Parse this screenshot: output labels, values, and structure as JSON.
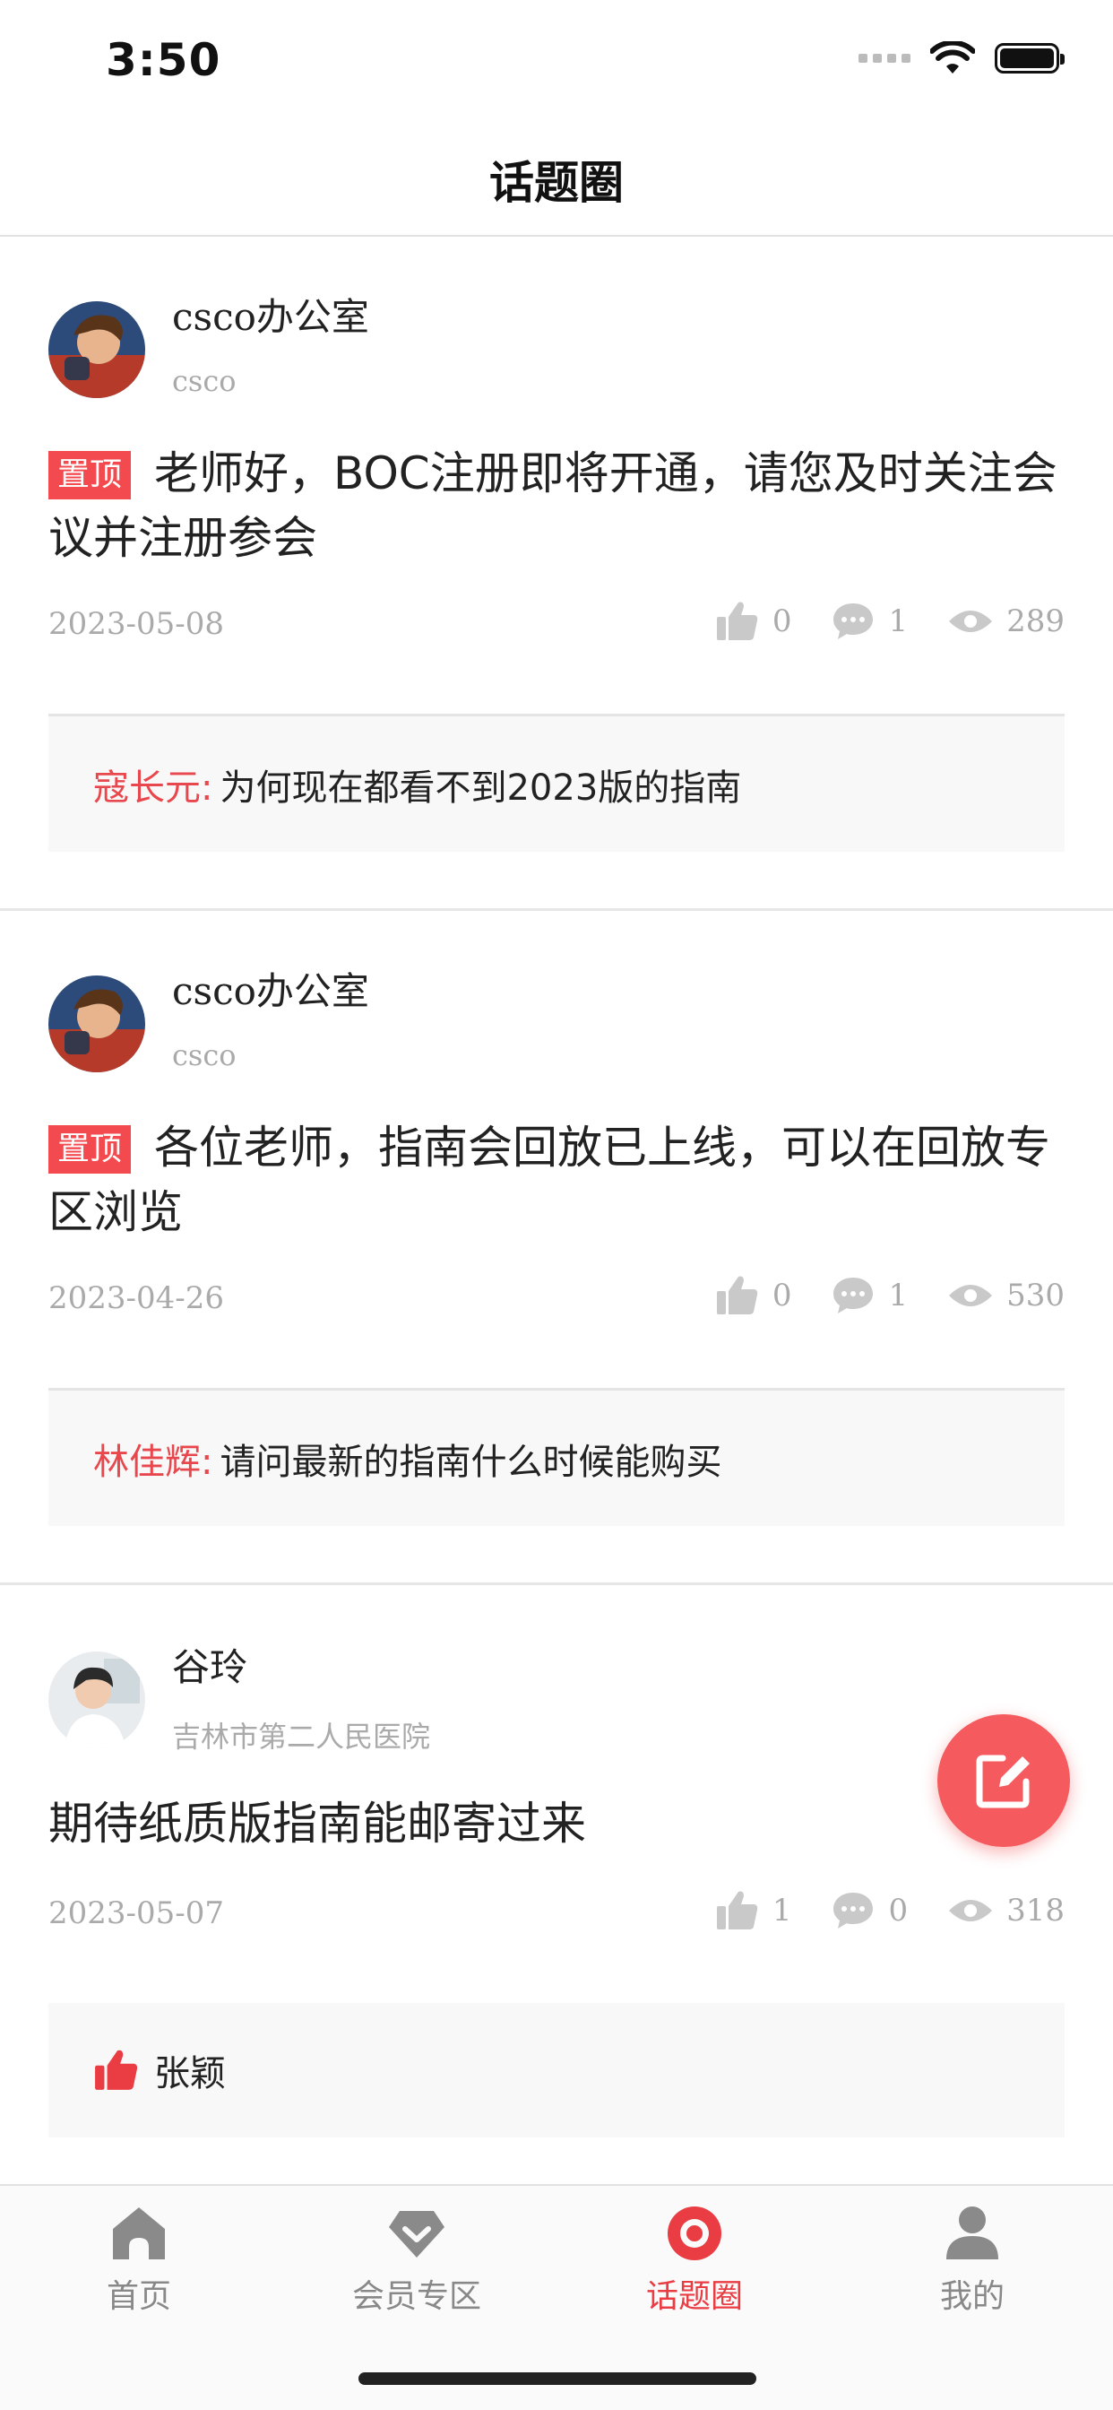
{
  "status_bar": {
    "time": "3:50"
  },
  "header": {
    "title": "话题圈"
  },
  "posts": [
    {
      "author": "csco办公室",
      "subline": "csco",
      "badge": "置顶",
      "text": "老师好，BOC注册即将开通，请您及时关注会议并注册参会",
      "date": "2023-05-08",
      "likes": "0",
      "comments": "1",
      "views": "289",
      "comment": {
        "name": "寇长元:",
        "text": "为何现在都看不到2023版的指南"
      }
    },
    {
      "author": "csco办公室",
      "subline": "csco",
      "badge": "置顶",
      "text": "各位老师，指南会回放已上线，可以在回放专区浏览",
      "date": "2023-04-26",
      "likes": "0",
      "comments": "1",
      "views": "530",
      "comment": {
        "name": "林佳辉:",
        "text": "请问最新的指南什么时候能购买"
      }
    },
    {
      "author": "谷玲",
      "subline": "吉林市第二人民医院",
      "text": "期待纸质版指南能邮寄过来",
      "date": "2023-05-07",
      "likes": "1",
      "comments": "0",
      "views": "318",
      "liked_by": "张颖"
    }
  ],
  "tabbar": {
    "items": [
      {
        "label": "首页",
        "icon": "home-icon"
      },
      {
        "label": "会员专区",
        "icon": "diamond-icon"
      },
      {
        "label": "话题圈",
        "icon": "topic-circle-icon",
        "active": true
      },
      {
        "label": "我的",
        "icon": "person-icon"
      }
    ]
  },
  "colors": {
    "accent": "#ea3c43",
    "badge": "#f24a4f",
    "fab": "#f45a5e"
  }
}
